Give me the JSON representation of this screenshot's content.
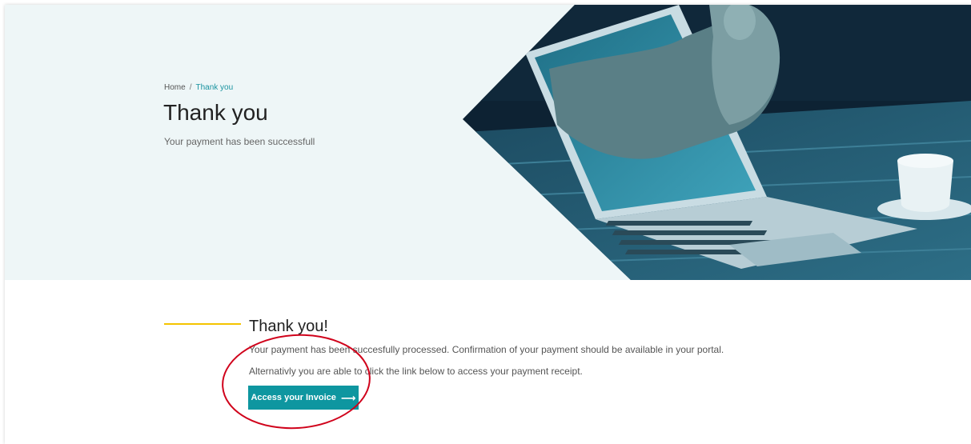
{
  "breadcrumb": {
    "home_label": "Home",
    "separator": "/",
    "current_label": "Thank you"
  },
  "hero": {
    "title": "Thank you",
    "subtitle": "Your payment has been successfull",
    "image_description_icon": "laptop-thumbs-up-photo"
  },
  "content": {
    "title": "Thank you!",
    "paragraph_1": "Your payment has been succesfully processed. Confirmation of your payment should be available in your portal.",
    "paragraph_2": "Alternativly you are able to click the link below to access your payment receipt.",
    "button_label": "Access your Invoice",
    "button_icon": "arrow-right-icon"
  },
  "colors": {
    "accent": "#f4c400",
    "button": "#0e96a0",
    "breadcrumb_current": "#1a93a0",
    "annotation": "#d0021b"
  }
}
